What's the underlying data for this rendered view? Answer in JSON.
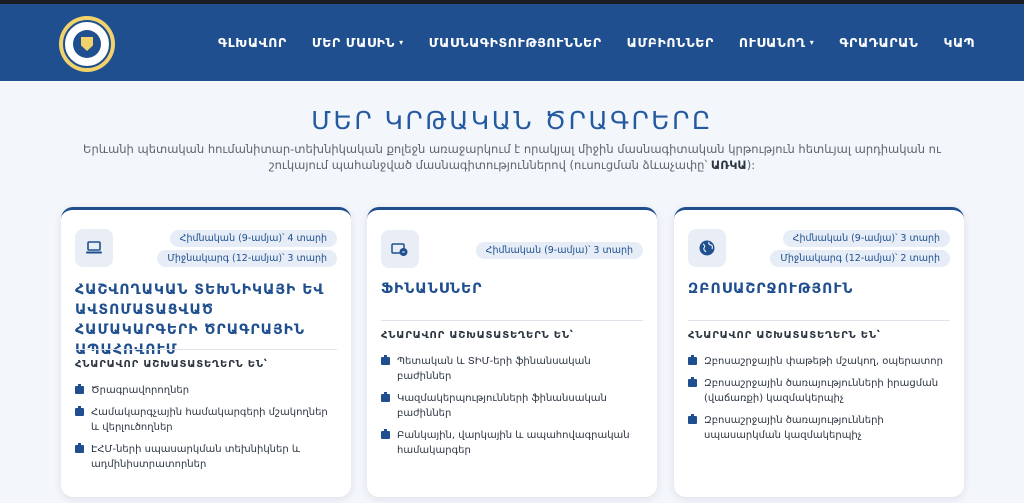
{
  "nav": {
    "items": [
      {
        "label": "ԳԼԽԱՎՈՐ",
        "dropdown": false
      },
      {
        "label": "ՄԵՐ ՄԱՍԻՆ",
        "dropdown": true
      },
      {
        "label": "ՄԱՍՆԱԳԻՏՈՒԹՅՈՒՆՆԵՐ",
        "dropdown": false
      },
      {
        "label": "ԱՄԲԻՈՆՆԵՐ",
        "dropdown": false
      },
      {
        "label": "ՈՒՍԱՆՈՂ",
        "dropdown": true
      },
      {
        "label": "ԳՐԱԴԱՐԱՆ",
        "dropdown": false
      },
      {
        "label": "ԿԱՊ",
        "dropdown": false
      }
    ],
    "caret": "▾"
  },
  "page": {
    "title": "ՄԵՐ ԿՐԹԱԿԱՆ ԾՐԱԳՐԵՐԸ",
    "intro_text": "Երևանի պետական հումանիտար-տեխնիկական քոլեջն առաջարկում է որակյալ միջին մասնագիտական կրթություն հետևյալ արդիական ու շուկայում պահանջված մասնագիտություններով (ուսուցման ձևաչափը՝ ",
    "intro_bold": "ԱՌԿԱ",
    "intro_end": "):"
  },
  "cards": [
    {
      "icon": "laptop-icon",
      "badges": [
        "Հիմնական (9-ամյա)՝ 4 տարի",
        "Միջնակարգ (12-ամյա)՝ 3 տարի"
      ],
      "title": "ՀԱՇՎՈՂԱԿԱՆ ՏԵԽՆԻԿԱՅԻ ԵՎ ԱՎՏՈՄԱՏԱՑՎԱԾ ՀԱՄԱԿԱՐԳԵՐԻ ԾՐԱԳՐԱՅԻՆ ԱՊԱՀՈՎՈՒՄ",
      "subtitle": "ՀՆԱՐԱՎՈՐ ԱՇԽԱՏԱՏԵՂԵՐՆ ԵՆ՝",
      "items": [
        "Ծրագրավորողներ",
        "Համակարգչային համակարգերի մշակողներ և վերլուծողներ",
        "ԷՀՄ-ների սպասարկման տեխնիկներ և ադմինիստրատորներ"
      ]
    },
    {
      "icon": "finance-icon",
      "badges": [
        "Հիմնական (9-ամյա)՝ 3 տարի"
      ],
      "title": "ՖԻՆԱՆՍՆԵՐ",
      "subtitle": "ՀՆԱՐԱՎՈՐ ԱՇԽԱՏԱՏԵՂԵՐՆ ԵՆ՝",
      "items": [
        "Պետական և ՏԻՄ-երի ֆինանսական բաժիններ",
        "Կազմակերպությունների ֆինանսական բաժիններ",
        "Բանկային, վարկային և ապահովագրական համակարգեր"
      ]
    },
    {
      "icon": "globe-icon",
      "badges": [
        "Հիմնական (9-ամյա)՝ 3 տարի",
        "Միջնակարգ (12-ամյա)՝ 2 տարի"
      ],
      "title": "ԶԲՈՍԱՇՐՋՈՒԹՅՈՒՆ",
      "subtitle": "ՀՆԱՐԱՎՈՐ ԱՇԽԱՏԱՏԵՂԵՐՆ ԵՆ՝",
      "items": [
        "Զբոսաշրջային փաթեթի մշակող, օպերատոր",
        "Զբոսաշրջային ծառայությունների իրացման (վաճառքի) կազմակերպիչ",
        "Զբոսաշրջային ծառայությունների սպասարկման կազմակերպիչ"
      ]
    }
  ]
}
